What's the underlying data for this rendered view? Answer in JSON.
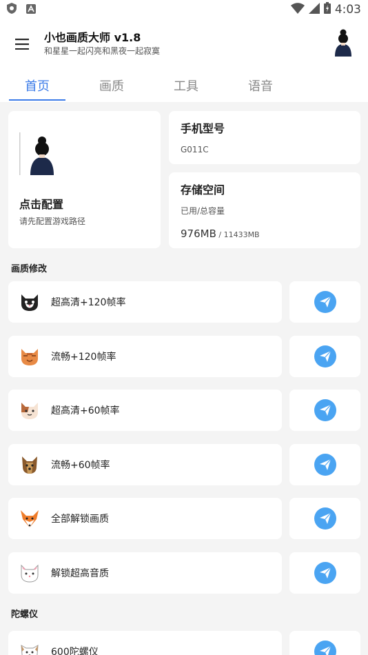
{
  "status_bar": {
    "time": "4:03"
  },
  "app_bar": {
    "title": "小也画质大师 v1.8",
    "subtitle": "和星星一起闪亮和黑夜一起寂寞"
  },
  "tabs": [
    {
      "label": "首页",
      "active": true
    },
    {
      "label": "画质",
      "active": false
    },
    {
      "label": "工具",
      "active": false
    },
    {
      "label": "语音",
      "active": false
    }
  ],
  "config_card": {
    "title": "点击配置",
    "subtitle": "请先配置游戏路径"
  },
  "phone_card": {
    "title": "手机型号",
    "value": "G011C"
  },
  "storage_card": {
    "title": "存储空间",
    "label": "已用/总容量",
    "used": "976MB",
    "total": " / 11433MB"
  },
  "sections": {
    "quality": "画质修改",
    "gyro": "陀螺仪"
  },
  "quality_items": [
    {
      "label": "超高清+120帧率",
      "icon": "black-white-cat-icon"
    },
    {
      "label": "流畅+120帧率",
      "icon": "orange-cat-icon"
    },
    {
      "label": "超高清+60帧率",
      "icon": "calico-cat-icon"
    },
    {
      "label": "流畅+60帧率",
      "icon": "yorkie-dog-icon"
    },
    {
      "label": "全部解锁画质",
      "icon": "fox-icon"
    },
    {
      "label": "解锁超高音质",
      "icon": "white-cat-icon"
    }
  ],
  "gyro_items": [
    {
      "label": "600陀螺仪",
      "icon": "white-dog-icon"
    }
  ],
  "colors": {
    "accent": "#3b7be8",
    "send_button": "#4aa4f2",
    "background": "#f4f4f4"
  }
}
